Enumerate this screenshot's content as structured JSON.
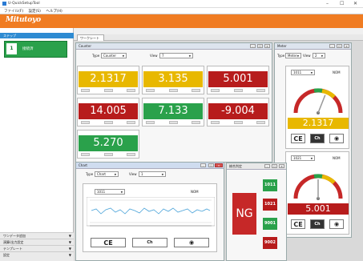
{
  "window": {
    "title": "U-QuickSetupTool",
    "controls": [
      "–",
      "☐",
      "✕"
    ]
  },
  "menu": [
    "ファイル(F)",
    "設定(S)",
    "ヘルプ(H)"
  ],
  "brand": "Mitutoyo",
  "colors": {
    "brand": "#f07c22",
    "yellow": "#e8b800",
    "red": "#b71c1c",
    "green": "#2aa14b",
    "sidebar_head": "#2e8bd2"
  },
  "sidebar": {
    "header": "ステップ",
    "item": {
      "num": "1",
      "label": "接続済"
    },
    "footer": [
      "ワンデータ追加",
      "演算/出力設定",
      "テンプレート",
      "設定"
    ]
  },
  "tab": "ワークシート",
  "counter": {
    "title": "Counter",
    "type_label": "Type",
    "type_value": "Counter",
    "view_label": "View",
    "view_value": "7",
    "cards": [
      {
        "value": "2.1317",
        "color": "yellow"
      },
      {
        "value": "3.135",
        "color": "yellow"
      },
      {
        "value": "5.001",
        "color": "red"
      },
      {
        "value": "14.005",
        "color": "red"
      },
      {
        "value": "7.133",
        "color": "green"
      },
      {
        "value": "-9.004",
        "color": "red"
      },
      {
        "value": "5.270",
        "color": "green"
      }
    ]
  },
  "meter": {
    "title": "Meter",
    "type_label": "Type",
    "type_value": "Meter",
    "view_label": "View",
    "view_value": "2",
    "gauges": [
      {
        "id": "1011",
        "status": "NOM",
        "value": "2.1317",
        "color": "yellow",
        "needle_fraction": 0.62
      },
      {
        "id": "1021",
        "status": "NOM",
        "value": "5.001",
        "color": "red",
        "needle_fraction": 0.5
      }
    ],
    "buttons": [
      "CE",
      "Ch",
      "◉"
    ]
  },
  "chart": {
    "title": "Chart",
    "type_label": "Type",
    "type_value": "Chart",
    "view_label": "View",
    "view_value": "1",
    "id": "1011",
    "status": "NOM",
    "buttons": [
      "CE",
      "Ch",
      "◉"
    ]
  },
  "judge": {
    "title": "総合判定",
    "result": "NG",
    "ids": [
      {
        "id": "1011",
        "color": "green"
      },
      {
        "id": "1021",
        "color": "red"
      },
      {
        "id": "9001",
        "color": "green"
      },
      {
        "id": "9002",
        "color": "red"
      }
    ]
  }
}
